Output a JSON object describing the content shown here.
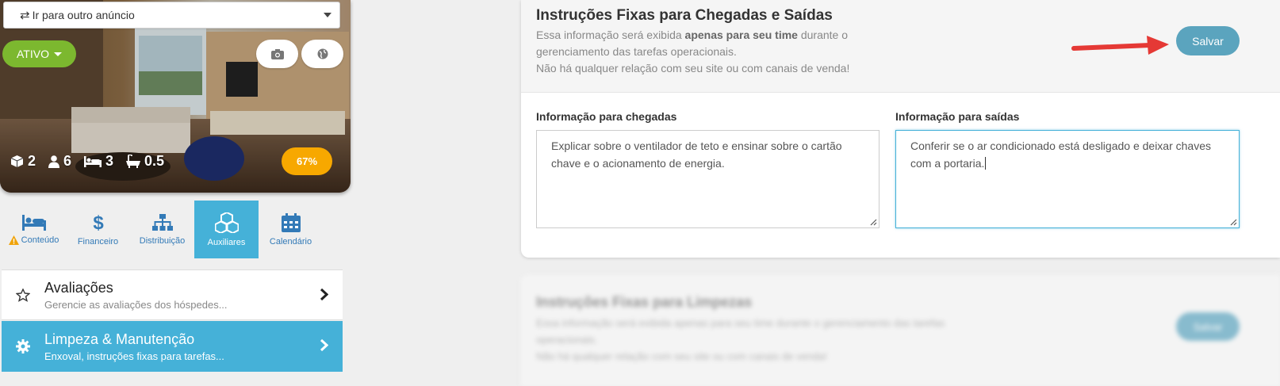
{
  "left": {
    "goto_select": "Ir para outro anúncio",
    "status": "ATIVO",
    "stats": {
      "rooms": "2",
      "guests": "6",
      "beds": "3",
      "baths": "0.5"
    },
    "completion": "67%",
    "tabs": [
      {
        "label": "Conteúdo",
        "icon": "bed-icon",
        "warning": true
      },
      {
        "label": "Financeiro",
        "icon": "dollar-icon"
      },
      {
        "label": "Distribuição",
        "icon": "sitemap-icon"
      },
      {
        "label": "Auxiliares",
        "icon": "cubes-icon",
        "active": true
      },
      {
        "label": "Calendário",
        "icon": "calendar-icon"
      }
    ],
    "menu": [
      {
        "title": "Avaliações",
        "subtitle": "Gerencie as avaliações dos hóspedes..."
      },
      {
        "title": "Limpeza & Manutenção",
        "subtitle": "Enxoval, instruções fixas para tarefas...",
        "active": true
      }
    ]
  },
  "card": {
    "title": "Instruções Fixas para Chegadas e Saídas",
    "desc_1": "Essa informação será exibida ",
    "desc_bold": "apenas para seu time",
    "desc_2": " durante o gerenciamento das tarefas operacionais.",
    "desc_3": "Não há qualquer relação com seu site ou com canais de venda!",
    "save": "Salvar",
    "arrival_label": "Informação para chegadas",
    "arrival_value": "Explicar sobre o ventilador de teto e ensinar sobre o cartão chave e o acionamento de energia.",
    "departure_label": "Informação para saídas",
    "departure_value": "Conferir se o ar condicionado está desligado e deixar chaves com a portaria."
  },
  "card2": {
    "title": "Instruções Fixas para Limpezas",
    "desc_1": "Essa informação será exibida apenas para seu time durante o gerenciamento das tarefas operacionais.",
    "desc_2": "Não há qualquer relação com seu site ou com canais de venda!",
    "save": "Salvar"
  },
  "colors": {
    "accent": "#45b1d8",
    "status_green": "#7cb82f",
    "badge_orange": "#f7a800",
    "save_blue": "#5ba4be",
    "arrow_red": "#e53935"
  }
}
